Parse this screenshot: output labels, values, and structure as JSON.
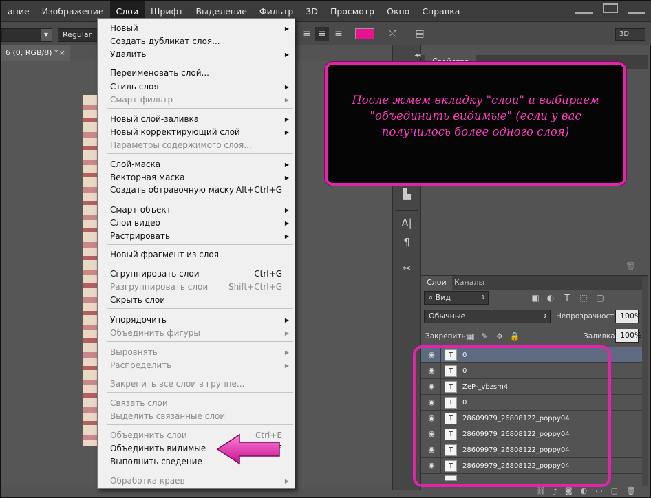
{
  "menubar": {
    "items": [
      "ание",
      "Изображение",
      "Слои",
      "Шрифт",
      "Выделение",
      "Фильтр",
      "3D",
      "Просмотр",
      "Окно",
      "Справка"
    ],
    "active_index": 2
  },
  "options_bar": {
    "font_style": "Regular",
    "color_hex": "#e8128f",
    "mode_3d": "3D"
  },
  "document_tab": {
    "title": "6 (0, RGB/8) *",
    "close": "×"
  },
  "properties_panel": {
    "tab": "Свойства"
  },
  "layers_panel": {
    "tabs": [
      "Слои",
      "Каналы"
    ],
    "filter_label": "Вид",
    "blend_mode": "Обычные",
    "opacity_label": "Непрозрачность:",
    "opacity_value": "100%",
    "lock_label": "Закрепить:",
    "fill_label": "Заливка:",
    "fill_value": "100%",
    "layers": [
      {
        "name": "0",
        "selected": true
      },
      {
        "name": "0",
        "selected": false
      },
      {
        "name": "ZeP-_vbzsm4",
        "selected": false
      },
      {
        "name": "0",
        "selected": false
      },
      {
        "name": "28609979_26808122_poppy04",
        "selected": false
      },
      {
        "name": "28609979_26808122_poppy04",
        "selected": false
      },
      {
        "name": "28609979_26808122_poppy04",
        "selected": false
      },
      {
        "name": "28609979_26808122_poppy04",
        "selected": false
      }
    ]
  },
  "menu": {
    "items": [
      {
        "label": "Новый",
        "submenu": true,
        "disabled": false
      },
      {
        "label": "Создать дубликат слоя...",
        "submenu": false,
        "disabled": false
      },
      {
        "label": "Удалить",
        "submenu": true,
        "disabled": false
      },
      {
        "label": "Переименовать слой...",
        "submenu": false,
        "disabled": false
      },
      {
        "label": "Стиль слоя",
        "submenu": true,
        "disabled": false
      },
      {
        "label": "Смарт-фильтр",
        "submenu": true,
        "disabled": true
      },
      {
        "label": "Новый слой-заливка",
        "submenu": true,
        "disabled": false
      },
      {
        "label": "Новый корректирующий слой",
        "submenu": true,
        "disabled": false
      },
      {
        "label": "Параметры содержимого слоя...",
        "submenu": false,
        "disabled": true
      },
      {
        "label": "Слой-маска",
        "submenu": true,
        "disabled": false
      },
      {
        "label": "Векторная маска",
        "submenu": true,
        "disabled": false
      },
      {
        "label": "Создать обтравочную маску",
        "shortcut": "Alt+Ctrl+G",
        "submenu": false,
        "disabled": false
      },
      {
        "label": "Смарт-объект",
        "submenu": true,
        "disabled": false
      },
      {
        "label": "Слои видео",
        "submenu": true,
        "disabled": false
      },
      {
        "label": "Растрировать",
        "submenu": true,
        "disabled": false
      },
      {
        "label": "Новый фрагмент из слоя",
        "submenu": false,
        "disabled": false
      },
      {
        "label": "Сгруппировать слои",
        "shortcut": "Ctrl+G",
        "submenu": false,
        "disabled": false
      },
      {
        "label": "Разгруппировать слои",
        "shortcut": "Shift+Ctrl+G",
        "submenu": false,
        "disabled": true
      },
      {
        "label": "Скрыть слои",
        "submenu": false,
        "disabled": false
      },
      {
        "label": "Упорядочить",
        "submenu": true,
        "disabled": false
      },
      {
        "label": "Объединить фигуры",
        "submenu": true,
        "disabled": true
      },
      {
        "label": "Выровнять",
        "submenu": true,
        "disabled": true
      },
      {
        "label": "Распределить",
        "submenu": true,
        "disabled": true
      },
      {
        "label": "Закрепить все слои в группе...",
        "submenu": false,
        "disabled": true
      },
      {
        "label": "Связать слои",
        "submenu": false,
        "disabled": true
      },
      {
        "label": "Выделить связанные слои",
        "submenu": false,
        "disabled": true
      },
      {
        "label": "Объединить слои",
        "shortcut": "Ctrl+E",
        "submenu": false,
        "disabled": true
      },
      {
        "label": "Объединить видимые",
        "shortcut": "E",
        "submenu": false,
        "disabled": false
      },
      {
        "label": "Выполнить сведение",
        "submenu": false,
        "disabled": false
      },
      {
        "label": "Обработка краев",
        "submenu": true,
        "disabled": true
      }
    ]
  },
  "annotation": {
    "text": "После жмем вкладку \"слои\" и выбираем \"объединить видимые\" (если у вас получилось более одного слоя)",
    "color_hex": "#e026a8"
  }
}
